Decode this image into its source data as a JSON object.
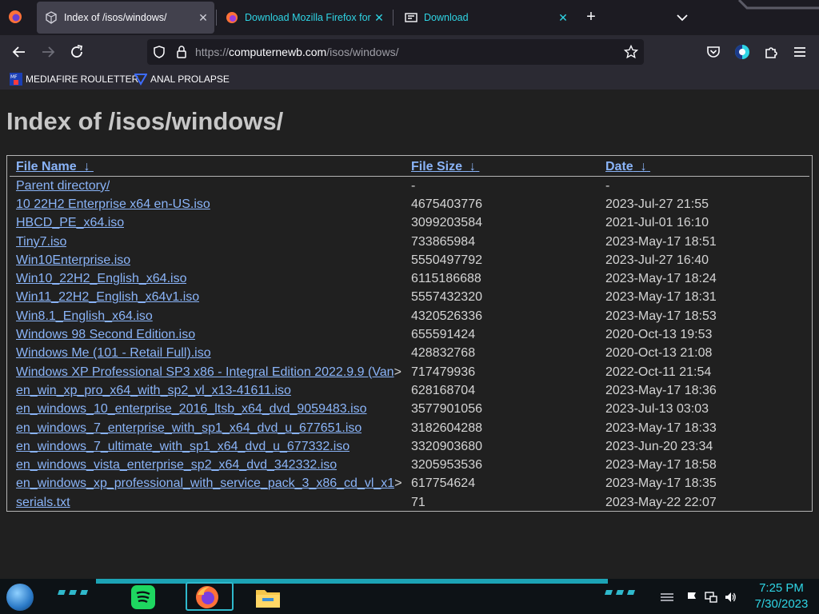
{
  "browser": {
    "tabs": [
      {
        "label": "Index of /isos/windows/",
        "icon": "page-icon",
        "active": true
      },
      {
        "label": "Download Mozilla Firefox for W",
        "icon": "firefox-icon",
        "active": false
      },
      {
        "label": "Download",
        "icon": "download-site-icon",
        "active": false
      }
    ],
    "close_glyph": "✕",
    "new_tab_glyph": "+",
    "url": {
      "prefix": "https://",
      "host": "computernewb.com",
      "path": "/isos/windows/"
    }
  },
  "bookmarks": [
    {
      "label": "MEDIAFIRE ROULETTER",
      "icon": "mediafire-icon"
    },
    {
      "label": "ANAL PROLAPSE",
      "icon": "bookmark-icon"
    }
  ],
  "page": {
    "title": "Index of /isos/windows/",
    "columns": {
      "name": "File Name",
      "size": "File Size",
      "date": "Date",
      "sort_glyph": "↓"
    },
    "rows": [
      {
        "name": "Parent directory/",
        "size": "-",
        "date": "-"
      },
      {
        "name": "10 22H2 Enterprise x64 en-US.iso",
        "size": "4675403776",
        "date": "2023-Jul-27 21:55"
      },
      {
        "name": "HBCD_PE_x64.iso",
        "size": "3099203584",
        "date": "2021-Jul-01 16:10"
      },
      {
        "name": "Tiny7.iso",
        "size": "733865984",
        "date": "2023-May-17 18:51"
      },
      {
        "name": "Win10Enterprise.iso",
        "size": "5550497792",
        "date": "2023-Jul-27 16:40"
      },
      {
        "name": "Win10_22H2_English_x64.iso",
        "size": "6115186688",
        "date": "2023-May-17 18:24"
      },
      {
        "name": "Win11_22H2_English_x64v1.iso",
        "size": "5557432320",
        "date": "2023-May-17 18:31"
      },
      {
        "name": "Win8.1_English_x64.iso",
        "size": "4320526336",
        "date": "2023-May-17 18:53"
      },
      {
        "name": "Windows 98 Second Edition.iso",
        "size": "655591424",
        "date": "2020-Oct-13 19:53"
      },
      {
        "name": "Windows Me (101 - Retail Full).iso",
        "size": "428832768",
        "date": "2020-Oct-13 21:08"
      },
      {
        "name": "Windows XP Professional SP3 x86 - Integral Edition 2022.9.9 (Van",
        "more": ">",
        "size": "717479936",
        "date": "2022-Oct-11 21:54"
      },
      {
        "name": "en_win_xp_pro_x64_with_sp2_vl_x13-41611.iso",
        "size": "628168704",
        "date": "2023-May-17 18:36"
      },
      {
        "name": "en_windows_10_enterprise_2016_ltsb_x64_dvd_9059483.iso",
        "size": "3577901056",
        "date": "2023-Jul-13 03:03"
      },
      {
        "name": "en_windows_7_enterprise_with_sp1_x64_dvd_u_677651.iso",
        "size": "3182604288",
        "date": "2023-May-17 18:33"
      },
      {
        "name": "en_windows_7_ultimate_with_sp1_x64_dvd_u_677332.iso",
        "size": "3320903680",
        "date": "2023-Jun-20 23:34"
      },
      {
        "name": "en_windows_vista_enterprise_sp2_x64_dvd_342332.iso",
        "size": "3205953536",
        "date": "2023-May-17 18:58"
      },
      {
        "name": "en_windows_xp_professional_with_service_pack_3_x86_cd_vl_x1",
        "more": ">",
        "size": "617754624",
        "date": "2023-May-17 18:35"
      },
      {
        "name": "serials.txt",
        "size": "71",
        "date": "2023-May-22 22:07"
      }
    ]
  },
  "taskbar": {
    "time": "7:25 PM",
    "date": "7/30/2023",
    "apps": [
      "spotify-icon",
      "firefox-icon",
      "file-explorer-icon"
    ],
    "colors": {
      "accent": "#2fd5e5",
      "band": "#1ca3b5"
    }
  }
}
